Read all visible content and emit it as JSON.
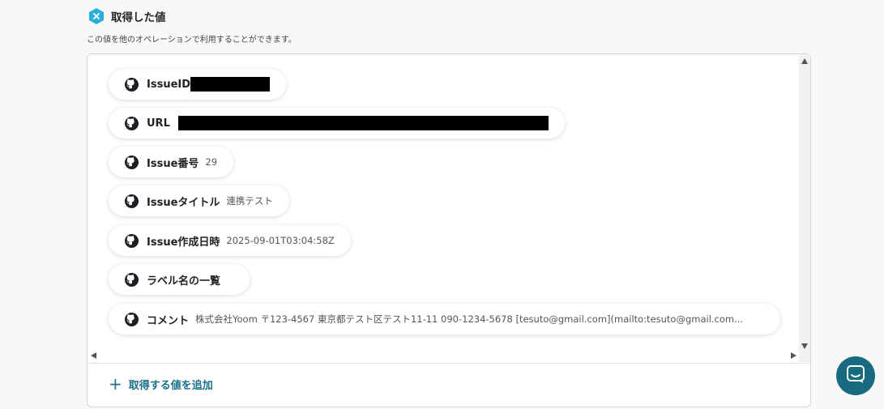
{
  "header": {
    "title": "取得した値",
    "subtitle": "この値を他のオペレーションで利用することができます。",
    "icon": "x-badge-icon",
    "icon_color": "#2ab0d8"
  },
  "fields": [
    {
      "label": "IssueID",
      "value": "",
      "redacted": true
    },
    {
      "label": "URL",
      "value": "",
      "redacted": true
    },
    {
      "label": "Issue番号",
      "value": "29"
    },
    {
      "label": "Issueタイトル",
      "value": "連携テスト"
    },
    {
      "label": "Issue作成日時",
      "value": "2025-09-01T03:04:58Z"
    },
    {
      "label": "ラベル名の一覧",
      "value": ""
    },
    {
      "label": "コメント",
      "value": "株式会社Yoom 〒123-4567 東京都テスト区テスト11-11 090-1234-5678 [tesuto@gmail.com](mailto:tesuto@gmail.com..."
    }
  ],
  "field_icon": "github-icon",
  "add_button": {
    "label": "取得する値を追加",
    "icon": "plus-icon"
  },
  "chat_button": {
    "icon": "chat-icon",
    "color": "#186b7f"
  }
}
